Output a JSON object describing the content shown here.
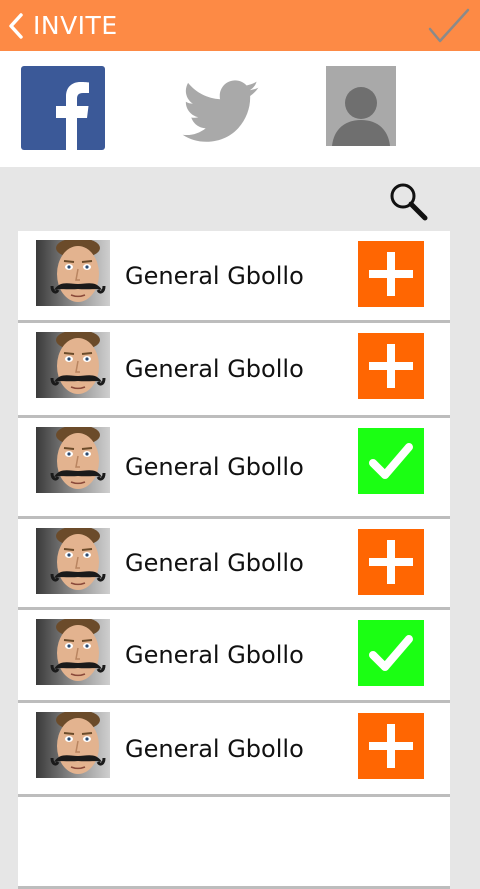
{
  "header": {
    "title": "INVITE",
    "back_icon": "chevron-left-icon",
    "confirm_icon": "checkmark-icon"
  },
  "sources": [
    {
      "name": "facebook",
      "icon": "facebook-icon",
      "color": "#3b5998"
    },
    {
      "name": "twitter",
      "icon": "twitter-bird-icon",
      "color": "#a9a9a9"
    },
    {
      "name": "contacts",
      "icon": "person-silhouette-icon",
      "color": "#a9a9a9"
    }
  ],
  "search": {
    "icon": "search-icon"
  },
  "contacts": [
    {
      "name": "General Gbollo",
      "status": "add"
    },
    {
      "name": "General Gbollo",
      "status": "add"
    },
    {
      "name": "General Gbollo",
      "status": "added"
    },
    {
      "name": "General Gbollo",
      "status": "add"
    },
    {
      "name": "General Gbollo",
      "status": "added"
    },
    {
      "name": "General Gbollo",
      "status": "add"
    },
    {
      "name": "",
      "status": ""
    }
  ],
  "colors": {
    "header": "#fd8a45",
    "add": "#ff6602",
    "added": "#1bff13",
    "background": "#e6e6e6"
  }
}
